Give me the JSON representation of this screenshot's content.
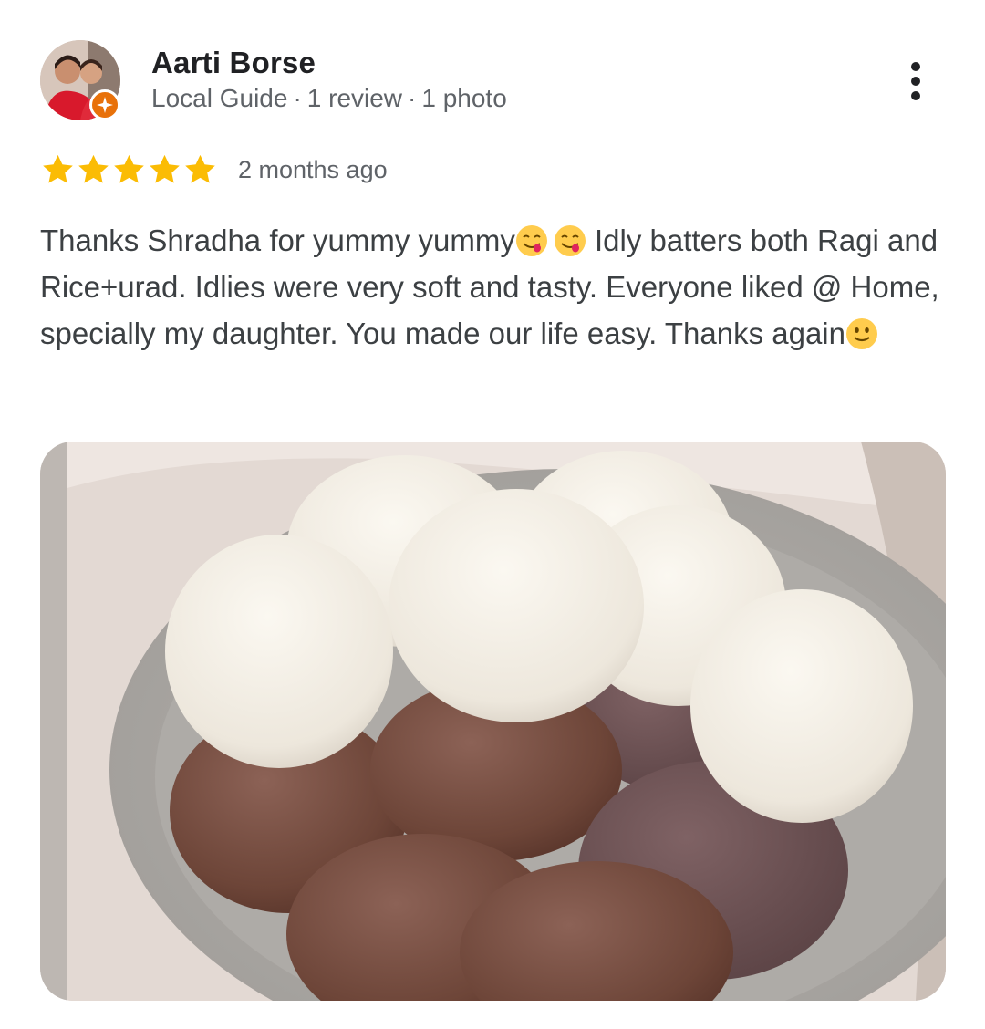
{
  "reviewer": {
    "name": "Aarti Borse",
    "badge": "Local Guide",
    "review_count": "1 review",
    "photo_count": "1 photo",
    "separator": "·"
  },
  "review": {
    "stars": 5,
    "time": "2 months ago",
    "text_1": "Thanks Shradha for yummy yummy",
    "text_2": " Idly batters both Ragi and Rice+urad. Idlies were very soft and tasty. Everyone liked @ Home, specially my daughter. You made our life easy. Thanks again",
    "emojis": [
      "face-savoring-food-emoji",
      "face-savoring-food-emoji",
      "slightly-smiling-face-emoji"
    ]
  },
  "icons": {
    "more": "more-vert-icon",
    "star": "star-icon",
    "local_guide": "local-guide-badge-icon"
  },
  "colors": {
    "star": "#fbbc04",
    "badge": "#e8710a",
    "secondary_text": "#5f6368",
    "body_text": "#3c4043"
  }
}
